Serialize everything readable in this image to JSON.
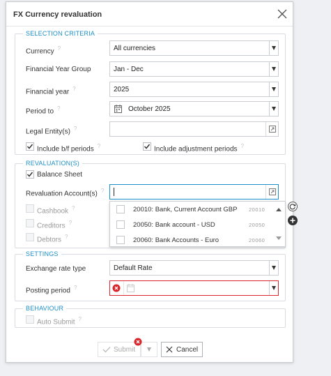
{
  "dialog": {
    "title": "FX Currency revaluation"
  },
  "selection": {
    "legend": "SELECTION CRITERIA",
    "currency_label": "Currency",
    "currency_value": "All currencies",
    "fy_group_label": "Financial Year Group",
    "fy_group_value": "Jan - Dec",
    "fy_label": "Financial year",
    "fy_value": "2025",
    "period_label": "Period to",
    "period_value": "October 2025",
    "legal_entity_label": "Legal Entity(s)",
    "legal_entity_value": "",
    "include_bf_label": "Include b/f periods",
    "include_adj_label": "Include adjustment periods"
  },
  "revaluation": {
    "legend": "REVALUATION(S)",
    "balance_sheet_label": "Balance Sheet",
    "accounts_label": "Revaluation Account(s)",
    "accounts_value": "",
    "cashbook_label": "Cashbook",
    "creditors_label": "Creditors",
    "debtors_label": "Debtors"
  },
  "accounts_dropdown": {
    "items": [
      {
        "name": "20010: Bank, Current Account GBP",
        "code": "20010"
      },
      {
        "name": "20050: Bank account - USD",
        "code": "20050"
      },
      {
        "name": "20060: Bank Accounts - Euro",
        "code": "20060"
      }
    ]
  },
  "settings": {
    "legend": "SETTINGS",
    "rate_type_label": "Exchange rate type",
    "rate_type_value": "Default Rate",
    "posting_period_label": "Posting period",
    "posting_period_value": ""
  },
  "behaviour": {
    "legend": "BEHAVIOUR",
    "auto_submit_label": "Auto Submit"
  },
  "footer": {
    "submit_label": "Submit",
    "cancel_label": "Cancel"
  },
  "colors": {
    "accent": "#1b8fc7",
    "error": "#d9262c",
    "border": "#c9ccd1"
  }
}
